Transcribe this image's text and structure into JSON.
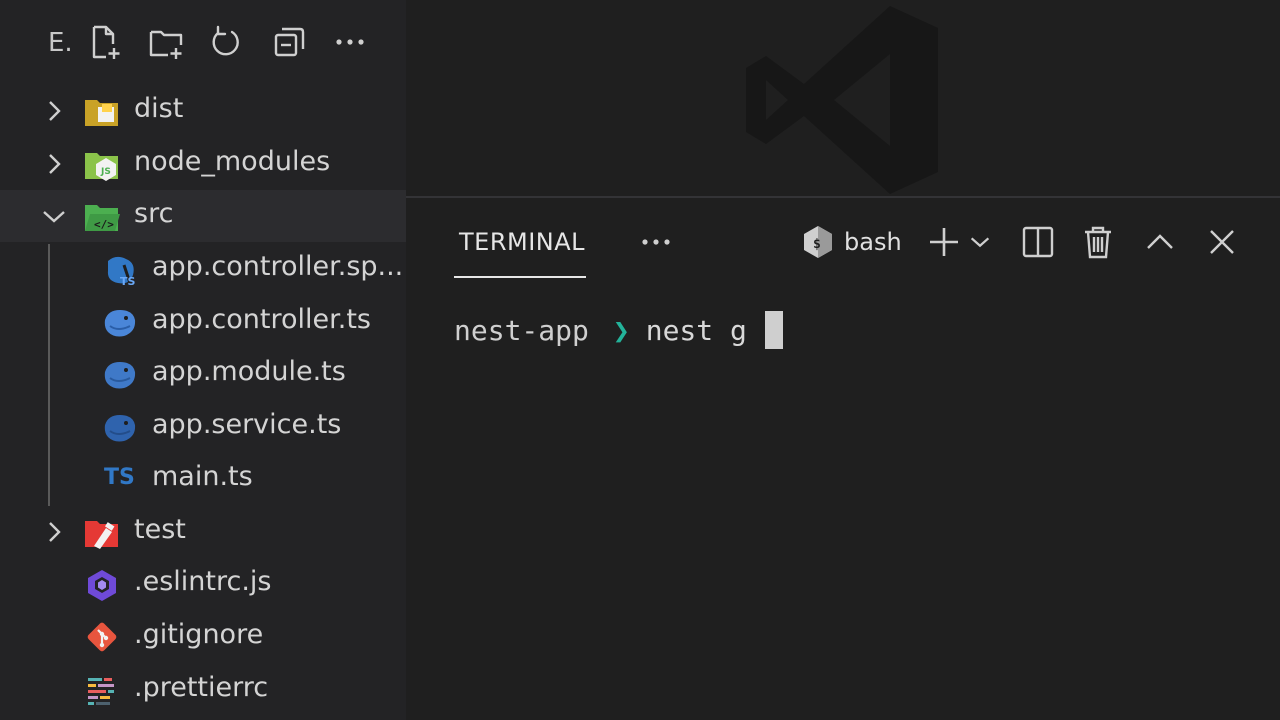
{
  "explorer": {
    "title": "E.",
    "actions": [
      "new-file",
      "new-folder",
      "refresh",
      "collapse-all",
      "more"
    ],
    "tree": [
      {
        "label": "dist",
        "kind": "folder",
        "expanded": false,
        "icon": "folder-dist-icon"
      },
      {
        "label": "node_modules",
        "kind": "folder",
        "expanded": false,
        "icon": "folder-node-icon"
      },
      {
        "label": "src",
        "kind": "folder",
        "expanded": true,
        "selected": true,
        "icon": "folder-src-icon"
      },
      {
        "label": "app.controller.sp...",
        "kind": "file",
        "icon": "nest-spec-icon"
      },
      {
        "label": "app.controller.ts",
        "kind": "file",
        "icon": "nest-controller-icon"
      },
      {
        "label": "app.module.ts",
        "kind": "file",
        "icon": "nest-module-icon"
      },
      {
        "label": "app.service.ts",
        "kind": "file",
        "icon": "nest-service-icon"
      },
      {
        "label": "main.ts",
        "kind": "file",
        "icon": "typescript-icon",
        "icon_text": "TS"
      },
      {
        "label": "test",
        "kind": "folder",
        "expanded": false,
        "icon": "folder-test-icon"
      },
      {
        "label": ".eslintrc.js",
        "kind": "file",
        "icon": "eslint-icon"
      },
      {
        "label": ".gitignore",
        "kind": "file",
        "icon": "git-icon"
      },
      {
        "label": ".prettierrc",
        "kind": "file",
        "icon": "prettier-icon"
      }
    ]
  },
  "panel": {
    "active_tab": "TERMINAL",
    "shell_label": "bash",
    "actions": [
      "new-terminal",
      "launch-profile",
      "split-terminal",
      "kill-terminal",
      "maximize-panel",
      "close-panel"
    ]
  },
  "terminal": {
    "prompt_dir": "nest-app",
    "prompt_symbol": "❯",
    "command": "nest g"
  },
  "colors": {
    "sidebar_bg": "#232325",
    "editor_bg": "#1f1f1f",
    "prompt_accent": "#23b39a",
    "ts_blue": "#3178c6",
    "nest_red": "#e0234e"
  }
}
